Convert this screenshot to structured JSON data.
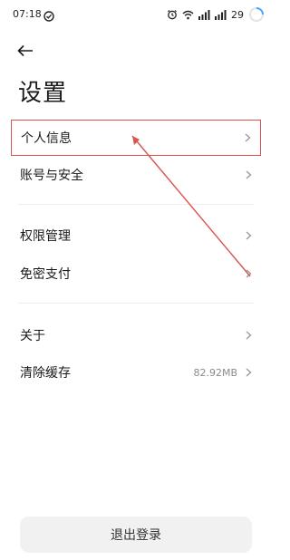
{
  "status_bar": {
    "time": "07:18",
    "battery": "29",
    "icons": [
      "check-circle-icon",
      "alarm-icon",
      "wifi-icon",
      "signal-icon",
      "signal-icon",
      "battery-ring-icon"
    ]
  },
  "header": {
    "back_icon": "arrow-left-icon",
    "title": "设置"
  },
  "groups": [
    {
      "items": [
        {
          "label": "个人信息",
          "value": "",
          "highlighted": true
        },
        {
          "label": "账号与安全",
          "value": ""
        }
      ]
    },
    {
      "items": [
        {
          "label": "权限管理",
          "value": ""
        },
        {
          "label": "免密支付",
          "value": ""
        }
      ]
    },
    {
      "items": [
        {
          "label": "关于",
          "value": ""
        },
        {
          "label": "清除缓存",
          "value": "82.92MB"
        }
      ]
    }
  ],
  "logout": {
    "label": "退出登录"
  },
  "colors": {
    "annotation": "#d9534f",
    "accent_ring": "#4aa3ff"
  }
}
